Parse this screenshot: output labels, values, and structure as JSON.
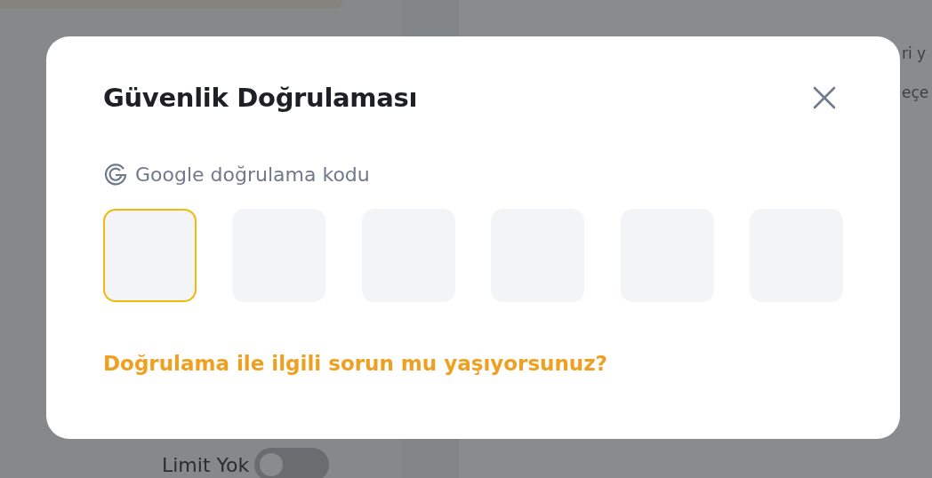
{
  "background": {
    "side_texts": [
      "ri y",
      "eçe"
    ],
    "limit_toggle": {
      "label": "Limit Yok",
      "on": false
    }
  },
  "modal": {
    "title": "Güvenlik Doğrulaması",
    "code_label": "Google doğrulama kodu",
    "code_digits": [
      {
        "selected": true
      },
      {
        "selected": false
      },
      {
        "selected": false
      },
      {
        "selected": false
      },
      {
        "selected": false
      },
      {
        "selected": false
      }
    ],
    "help_link": "Doğrulama ile ilgili sorun mu yaşıyorsunuz?"
  }
}
